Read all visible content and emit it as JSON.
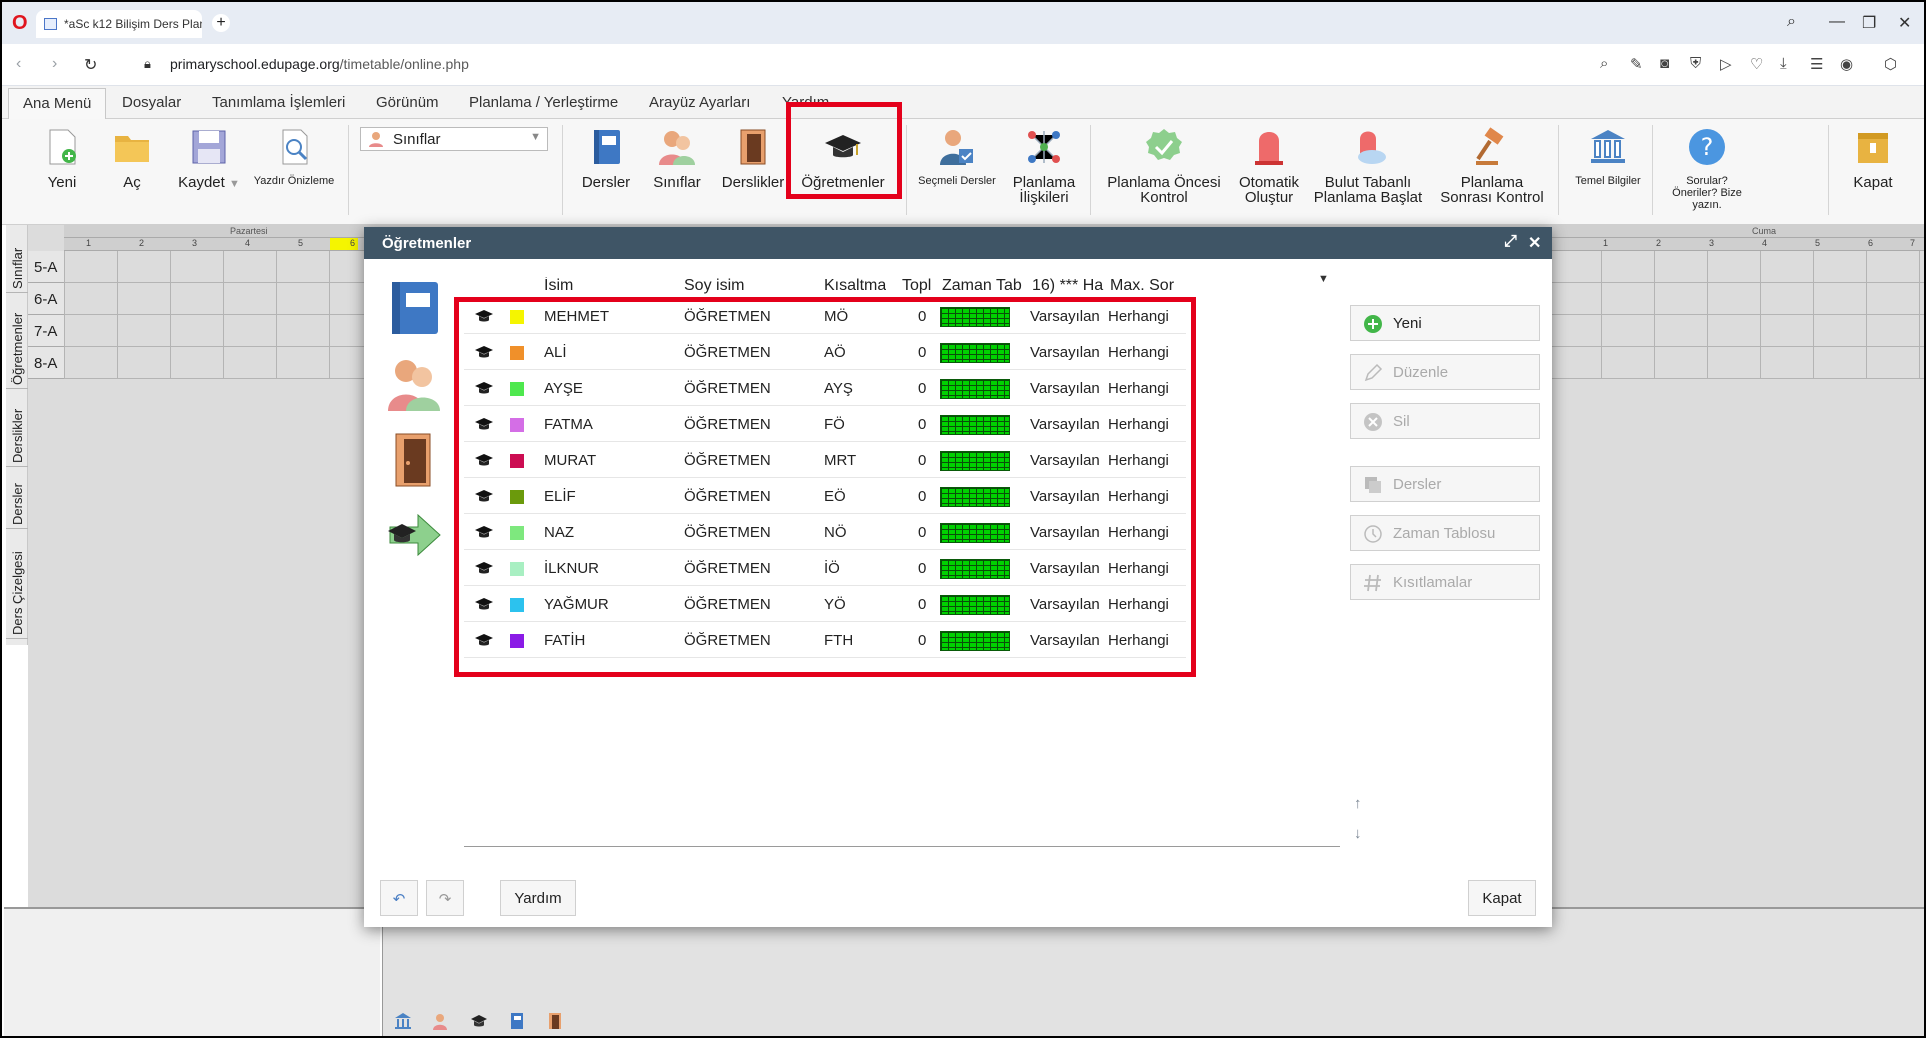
{
  "browser": {
    "tab_title": "*aSc k12 Bilişim Ders Plan",
    "new_tab": "+",
    "url_host": "primaryschool.edupage.org",
    "url_path": "/timetable/online.php"
  },
  "menu": [
    "Ana Menü",
    "Dosyalar",
    "Tanımlama İşlemleri",
    "Görünüm",
    "Planlama / Yerleştirme",
    "Arayüz Ayarları",
    "Yardım"
  ],
  "ribbon": {
    "new": "Yeni",
    "open": "Aç",
    "save": "Kaydet",
    "print_preview": "Yazdır Önizleme",
    "view_select": "Sınıflar",
    "subjects": "Dersler",
    "classes": "Sınıflar",
    "rooms": "Derslikler",
    "teachers": "Öğretmenler",
    "electives": "Seçmeli Dersler",
    "relations_1": "Planlama",
    "relations_2": "İlişkileri",
    "precheck_1": "Planlama Öncesi",
    "precheck_2": "Kontrol",
    "autogen_1": "Otomatik",
    "autogen_2": "Oluştur",
    "cloud_1": "Bulut Tabanlı",
    "cloud_2": "Planlama Başlat",
    "postcheck_1": "Planlama",
    "postcheck_2": "Sonrası Kontrol",
    "basic_info": "Temel Bilgiler",
    "questions_1": "Sorular?",
    "questions_2": "Öneriler? Bize",
    "questions_3": "yazın.",
    "close": "Kapat"
  },
  "vtabs": [
    "Sınıflar",
    "Öğretmenler",
    "Derslikler",
    "Dersler",
    "Ders Çizelgesi"
  ],
  "timetable": {
    "day_left": "Pazartesi",
    "day_right": "Cuma",
    "periods": [
      "1",
      "2",
      "3",
      "4",
      "5",
      "6",
      "7"
    ],
    "rows": [
      "5-A",
      "6-A",
      "7-A",
      "8-A"
    ]
  },
  "dialog": {
    "title": "Öğretmenler",
    "columns": [
      "İsim",
      "Soy isim",
      "Kısaltma",
      "Topl",
      "Zaman Tab",
      "16) *** Ha",
      "Max. Sor"
    ],
    "teachers": [
      {
        "name": "MEHMET",
        "surname": "ÖĞRETMEN",
        "short": "MÖ",
        "total": "0",
        "profile": "Varsayılan",
        "max": "Herhangi",
        "color": "#f5f500"
      },
      {
        "name": "ALİ",
        "surname": "ÖĞRETMEN",
        "short": "AÖ",
        "total": "0",
        "profile": "Varsayılan",
        "max": "Herhangi",
        "color": "#f0902a"
      },
      {
        "name": "AYŞE",
        "surname": "ÖĞRETMEN",
        "short": "AYŞ",
        "total": "0",
        "profile": "Varsayılan",
        "max": "Herhangi",
        "color": "#4ee84e"
      },
      {
        "name": "FATMA",
        "surname": "ÖĞRETMEN",
        "short": "FÖ",
        "total": "0",
        "profile": "Varsayılan",
        "max": "Herhangi",
        "color": "#d46ee6"
      },
      {
        "name": "MURAT",
        "surname": "ÖĞRETMEN",
        "short": "MRT",
        "total": "0",
        "profile": "Varsayılan",
        "max": "Herhangi",
        "color": "#cc0d52"
      },
      {
        "name": "ELİF",
        "surname": "ÖĞRETMEN",
        "short": "EÖ",
        "total": "0",
        "profile": "Varsayılan",
        "max": "Herhangi",
        "color": "#6b9a0c"
      },
      {
        "name": "NAZ",
        "surname": "ÖĞRETMEN",
        "short": "NÖ",
        "total": "0",
        "profile": "Varsayılan",
        "max": "Herhangi",
        "color": "#7ee87e"
      },
      {
        "name": "İLKNUR",
        "surname": "ÖĞRETMEN",
        "short": "İÖ",
        "total": "0",
        "profile": "Varsayılan",
        "max": "Herhangi",
        "color": "#a8efc2"
      },
      {
        "name": "YAĞMUR",
        "surname": "ÖĞRETMEN",
        "short": "YÖ",
        "total": "0",
        "profile": "Varsayılan",
        "max": "Herhangi",
        "color": "#2cc2ee"
      },
      {
        "name": "FATİH",
        "surname": "ÖĞRETMEN",
        "short": "FTH",
        "total": "0",
        "profile": "Varsayılan",
        "max": "Herhangi",
        "color": "#8a1be6"
      }
    ],
    "actions": {
      "new": "Yeni",
      "edit": "Düzenle",
      "delete": "Sil",
      "lessons": "Dersler",
      "timetable": "Zaman Tablosu",
      "constraints": "Kısıtlamalar"
    },
    "help": "Yardım",
    "close": "Kapat"
  },
  "colors": {
    "highlight": "#e4001b",
    "dialog_title_bg": "#3f5566",
    "availability_green": "#00d100"
  }
}
